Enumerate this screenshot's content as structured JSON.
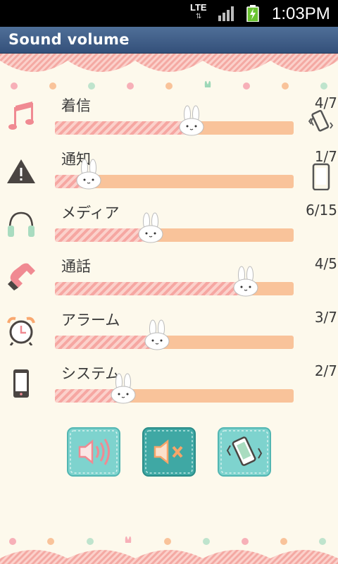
{
  "status_bar": {
    "network": "LTE",
    "time": "1:03PM"
  },
  "app": {
    "title": "Sound volume"
  },
  "rows": [
    {
      "label": "着信",
      "value_text": "4/7",
      "level": 4,
      "max": 7,
      "icon": "music-note-icon",
      "status_icon": "vibrate-phone-icon"
    },
    {
      "label": "通知",
      "value_text": "1/7",
      "level": 1,
      "max": 7,
      "icon": "warning-icon",
      "status_icon": "phone-icon"
    },
    {
      "label": "メディア",
      "value_text": "6/15",
      "level": 6,
      "max": 15,
      "icon": "headphones-icon",
      "status_icon": ""
    },
    {
      "label": "通話",
      "value_text": "4/5",
      "level": 4,
      "max": 5,
      "icon": "telephone-receiver-icon",
      "status_icon": ""
    },
    {
      "label": "アラーム",
      "value_text": "3/7",
      "level": 3,
      "max": 7,
      "icon": "alarm-clock-icon",
      "status_icon": ""
    },
    {
      "label": "システム",
      "value_text": "2/7",
      "level": 2,
      "max": 7,
      "icon": "smartphone-icon",
      "status_icon": ""
    }
  ],
  "mode_buttons": [
    {
      "name": "sound-on-button",
      "icon": "speaker-on-icon"
    },
    {
      "name": "mute-button",
      "icon": "speaker-mute-icon"
    },
    {
      "name": "vibrate-button",
      "icon": "vibrate-icon"
    }
  ],
  "colors": {
    "accent_pink": "#f6a7a2",
    "accent_peach": "#f9c39a",
    "button_teal": "#5ec3c0",
    "button_teal_dark": "#3aa7a4",
    "title_bar": "#3e5d86"
  }
}
